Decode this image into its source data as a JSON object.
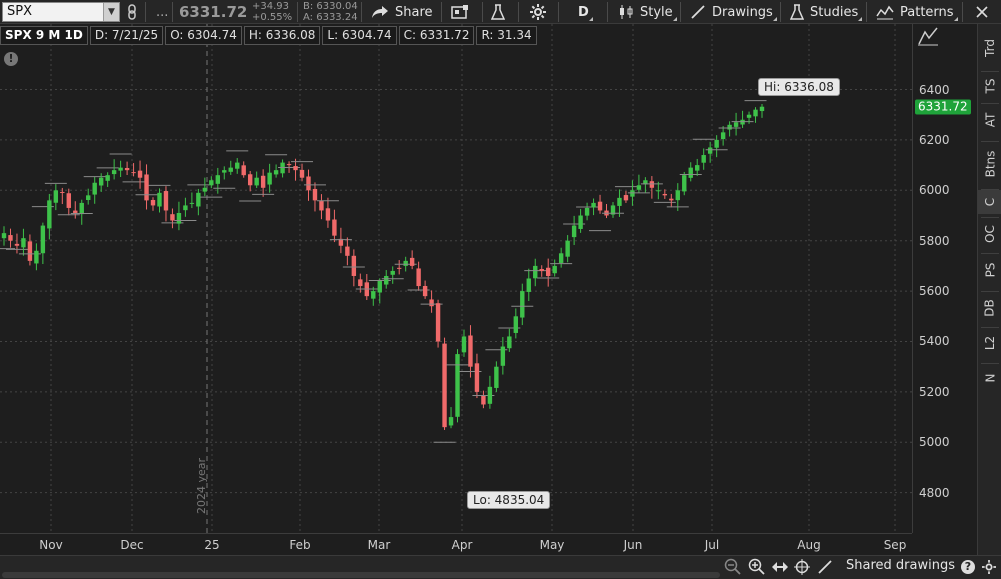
{
  "toolbar": {
    "symbol": "SPX",
    "more_label": "...",
    "last_price": "6331.72",
    "net_change": "+34.93",
    "pct_change": "+0.55%",
    "bid": "B: 6330.04",
    "ask": "A: 6333.24",
    "share_label": "Share",
    "period_label": "D",
    "style_label": "Style",
    "drawings_label": "Drawings",
    "studies_label": "Studies",
    "patterns_label": "Patterns"
  },
  "info_row": {
    "title": "SPX 9 M 1D",
    "date": "D: 7/21/25",
    "open": "O: 6304.74",
    "high": "H: 6336.08",
    "low": "L: 6304.74",
    "close": "C: 6331.72",
    "range": "R: 31.34"
  },
  "right_tabs": [
    "Trd",
    "TS",
    "AT",
    "Btns",
    "C",
    "OC",
    "PS",
    "DB",
    "L2",
    "N"
  ],
  "bottom": {
    "shared_drawings_label": "Shared drawings"
  },
  "chart_data": {
    "type": "candlestick",
    "y_ticks": [
      "6400",
      "6200",
      "6000",
      "5800",
      "5600",
      "5400",
      "5200",
      "5000",
      "4800"
    ],
    "x_ticks": [
      "Nov",
      "Dec",
      "25",
      "Feb",
      "Mar",
      "Apr",
      "May",
      "Jun",
      "Jul",
      "Aug",
      "Sep"
    ],
    "ylim": [
      4640,
      6660
    ],
    "year_marker": "2024 year",
    "current_price_label": "6331.72",
    "high_callout": "Hi: 6336.08",
    "low_callout": "Lo: 4835.04",
    "colors": {
      "up": "#3ec24a",
      "down": "#f06a6a",
      "flat_up": "#6ab0e6",
      "price_tag": "#1fa33a",
      "background": "#1e1e1e",
      "grid": "#444444"
    },
    "closes": [
      5830,
      5800,
      5780,
      5810,
      5720,
      5760,
      5860,
      5960,
      6000,
      5990,
      5930,
      5910,
      5950,
      5980,
      6030,
      6050,
      6060,
      6080,
      6090,
      6080,
      6070,
      6050,
      5960,
      5940,
      5990,
      5920,
      5880,
      5910,
      5940,
      5950,
      5990,
      6010,
      6040,
      6060,
      6080,
      6090,
      6110,
      6060,
      6020,
      6050,
      6010,
      6070,
      6080,
      6110,
      6100,
      6080,
      6050,
      6000,
      5960,
      5920,
      5880,
      5820,
      5780,
      5740,
      5660,
      5620,
      5580,
      5600,
      5640,
      5660,
      5680,
      5690,
      5720,
      5700,
      5620,
      5580,
      5540,
      5400,
      5060,
      5100,
      5350,
      5420,
      5300,
      5200,
      5150,
      5220,
      5300,
      5380,
      5420,
      5500,
      5600,
      5650,
      5700,
      5680,
      5660,
      5700,
      5750,
      5800,
      5860,
      5900,
      5930,
      5950,
      5920,
      5900,
      5940,
      5970,
      5960,
      6000,
      6020,
      6040,
      6010,
      6000,
      5980,
      5960,
      6000,
      6060,
      6090,
      6100,
      6140,
      6170,
      6200,
      6230,
      6260,
      6270,
      6280,
      6300,
      6320,
      6331.72
    ]
  }
}
